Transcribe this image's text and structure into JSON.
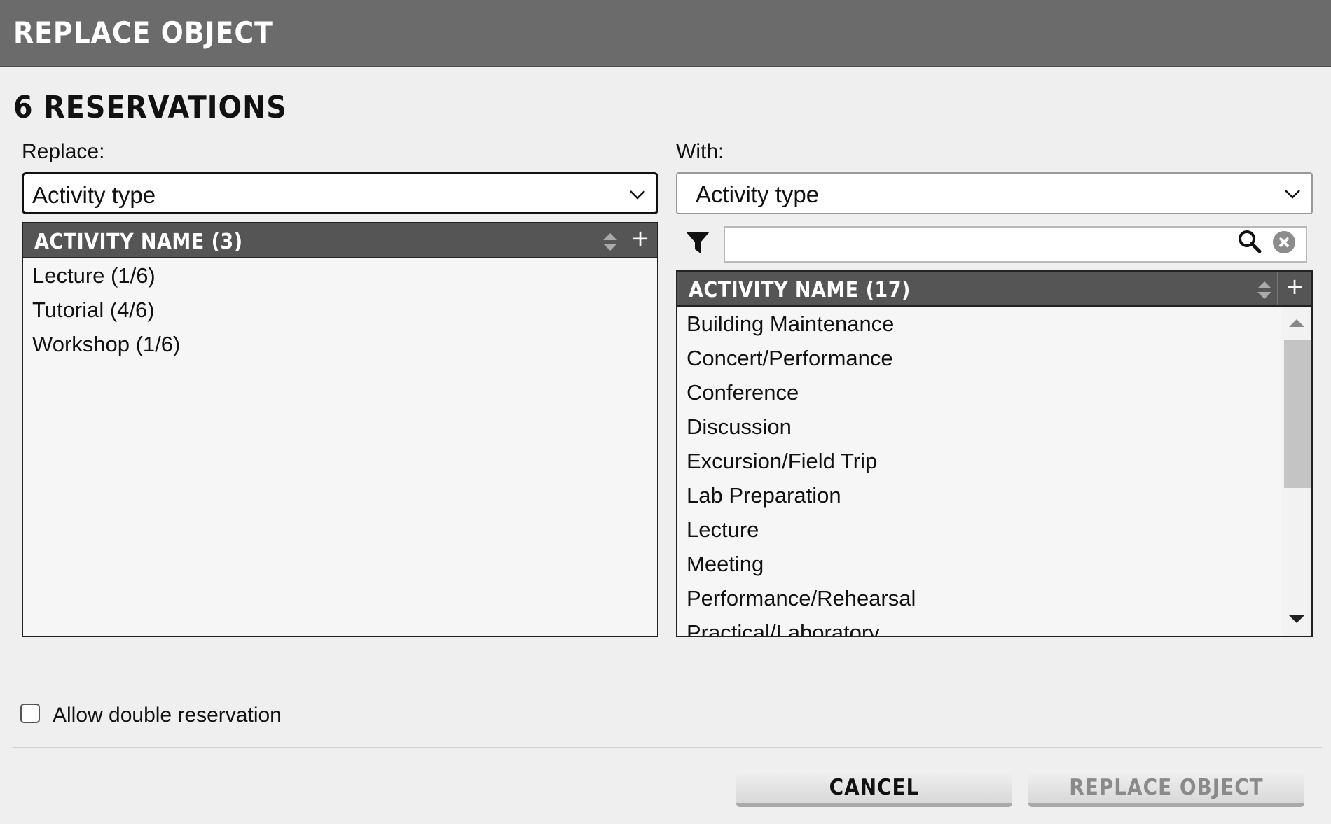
{
  "dialog": {
    "title": "REPLACE OBJECT",
    "heading": "6 RESERVATIONS"
  },
  "replace": {
    "label": "Replace:",
    "select_value": "Activity type",
    "list": {
      "header": "ACTIVITY NAME (3)",
      "items": [
        "Lecture (1/6)",
        "Tutorial (4/6)",
        "Workshop (1/6)"
      ]
    }
  },
  "with": {
    "label": "With:",
    "select_value": "Activity type",
    "filter_value": "",
    "list": {
      "header": "ACTIVITY NAME (17)",
      "items": [
        "Building Maintenance",
        "Concert/Performance",
        "Conference",
        "Discussion",
        "Excursion/Field Trip",
        "Lab Preparation",
        "Lecture",
        "Meeting",
        "Performance/Rehearsal",
        "Practical/Laboratory"
      ]
    }
  },
  "options": {
    "double_reservation_label": "Allow double reservation",
    "double_reservation_checked": false
  },
  "buttons": {
    "cancel": "CANCEL",
    "replace": "REPLACE OBJECT"
  },
  "colors": {
    "titlebar": "#6b6b6b",
    "list_header": "#555555",
    "disabled_text": "#8a8a8a"
  },
  "icons": [
    "chevron-down-icon",
    "sort-icon",
    "plus-icon",
    "filter-icon",
    "search-icon",
    "clear-icon"
  ]
}
